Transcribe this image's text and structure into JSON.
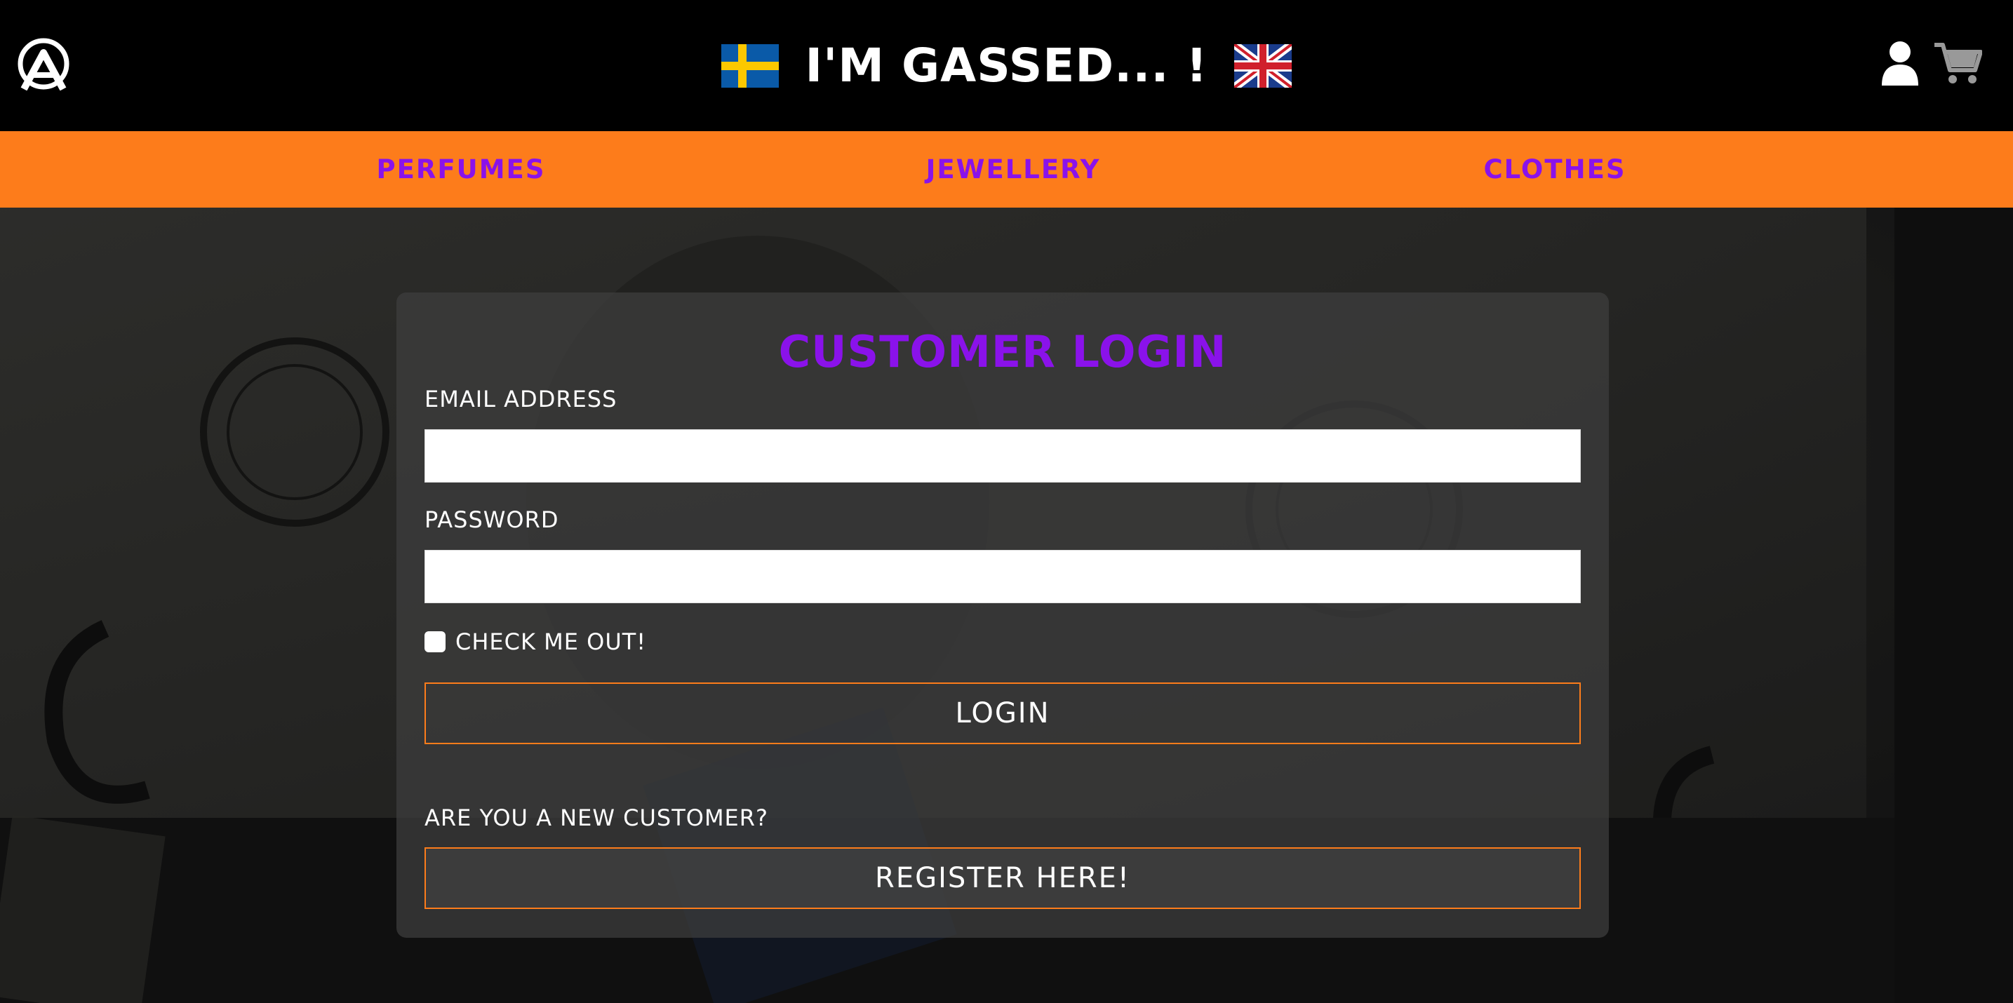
{
  "header": {
    "title": "I'M GASSED... !",
    "logo_icon": "brand-logo-icon",
    "left_flag": "sweden-flag-icon",
    "right_flag": "uk-flag-icon",
    "account_icon": "user-icon",
    "cart_icon": "cart-icon"
  },
  "nav": {
    "items": [
      {
        "label": "PERFUMES"
      },
      {
        "label": "JEWELLERY"
      },
      {
        "label": "CLOTHES"
      }
    ]
  },
  "login": {
    "title": "CUSTOMER LOGIN",
    "email_label": "EMAIL ADDRESS",
    "email_value": "",
    "password_label": "PASSWORD",
    "password_value": "",
    "remember_label": "CHECK ME OUT!",
    "remember_checked": false,
    "login_button": "LOGIN",
    "new_customer_text": "ARE YOU A NEW CUSTOMER?",
    "register_button": "REGISTER HERE!"
  },
  "colors": {
    "accent_orange": "#fd7c1b",
    "accent_purple": "#8a12ea",
    "header_bg": "#000000"
  }
}
